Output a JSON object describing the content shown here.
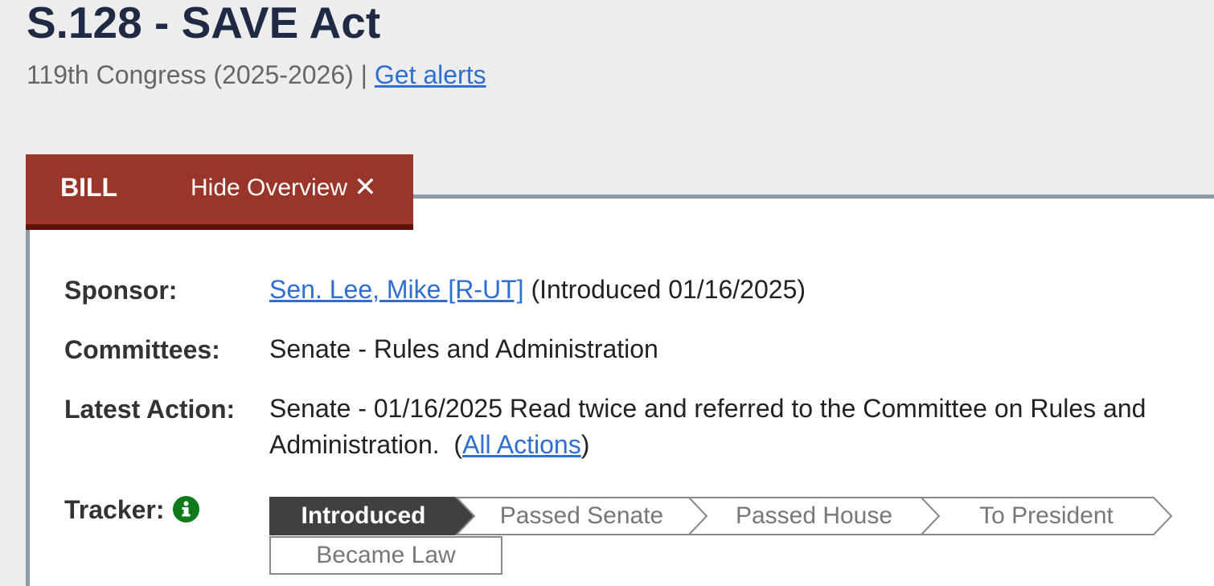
{
  "bill": {
    "title": "S.128 - SAVE Act",
    "congress": "119th Congress (2025-2026)",
    "separator": "|",
    "alerts_link": "Get alerts"
  },
  "tabs": {
    "bill": "BILL",
    "hide_overview": "Hide Overview",
    "close_glyph": "✕"
  },
  "overview": {
    "sponsor_label": "Sponsor:",
    "sponsor_name": "Sen. Lee, Mike [R-UT]",
    "sponsor_intro": "(Introduced 01/16/2025)",
    "committees_label": "Committees:",
    "committees_value": "Senate - Rules and Administration",
    "latest_action_label": "Latest Action:",
    "latest_action_line1": "Senate - 01/16/2025 Read twice and referred to the Committee on Rules and",
    "latest_action_line2": "Administration.",
    "latest_action_open": "(",
    "all_actions_link": "All Actions",
    "latest_action_close": ")",
    "tracker_label": "Tracker:",
    "tracker_icon": "info-icon"
  },
  "tracker": {
    "steps": [
      {
        "label": "Introduced",
        "status": "done"
      },
      {
        "label": "Passed Senate",
        "status": "todo"
      },
      {
        "label": "Passed House",
        "status": "todo"
      },
      {
        "label": "To President",
        "status": "todo"
      },
      {
        "label": "Became Law",
        "status": "todo"
      }
    ]
  },
  "colors": {
    "tab_background": "#9a3529",
    "tab_border": "#5a130f",
    "tracker_done": "#404040",
    "link": "#2f6fd1",
    "info_icon": "#0f7a1c",
    "title": "#1f2a44"
  }
}
